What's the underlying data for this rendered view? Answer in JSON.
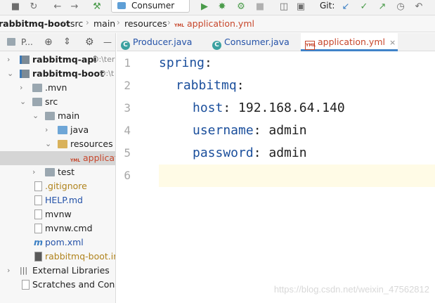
{
  "toolbar": {
    "run_config": "Consumer",
    "git_label": "Git:"
  },
  "breadcrumb": {
    "items": [
      "rabbitmq-boot",
      "src",
      "main",
      "resources",
      "application.yml"
    ],
    "separator": "›"
  },
  "project_panel": {
    "header_label": "P...",
    "tree": [
      {
        "label": "rabbitmq-api",
        "suffix": "D:\\ter"
      },
      {
        "label": "rabbitmq-boot",
        "suffix": "D:\\t"
      },
      {
        "label": ".mvn"
      },
      {
        "label": "src"
      },
      {
        "label": "main"
      },
      {
        "label": "java"
      },
      {
        "label": "resources"
      },
      {
        "label": "applicati"
      },
      {
        "label": "test"
      },
      {
        "label": ".gitignore"
      },
      {
        "label": "HELP.md"
      },
      {
        "label": "mvnw"
      },
      {
        "label": "mvnw.cmd"
      },
      {
        "label": "pom.xml"
      },
      {
        "label": "rabbitmq-boot.im"
      },
      {
        "label": "External Libraries"
      },
      {
        "label": "Scratches and Conso"
      }
    ]
  },
  "editor": {
    "tabs": [
      {
        "label": "Producer.java",
        "badge": "C"
      },
      {
        "label": "Consumer.java",
        "badge": "C"
      },
      {
        "label": "application.yml",
        "badge": "YML",
        "close": "×"
      }
    ],
    "lines": [
      {
        "number": "1",
        "key": "spring",
        "colon": ":",
        "value": ""
      },
      {
        "number": "2",
        "key": "rabbitmq",
        "colon": ":",
        "value": ""
      },
      {
        "number": "3",
        "key": "host",
        "colon": ":",
        "value": " 192.168.64.140"
      },
      {
        "number": "4",
        "key": "username",
        "colon": ":",
        "value": " admin"
      },
      {
        "number": "5",
        "key": "password",
        "colon": ":",
        "value": " admin"
      },
      {
        "number": "6",
        "key": "",
        "colon": "",
        "value": ""
      }
    ]
  },
  "watermark": "https://blog.csdn.net/weixin_47562812",
  "colors": {
    "yaml_key": "#1b4f9c",
    "yaml_file": "#c7462b",
    "active_tab_underline": "#4083c9",
    "current_line": "#fffbe6"
  }
}
